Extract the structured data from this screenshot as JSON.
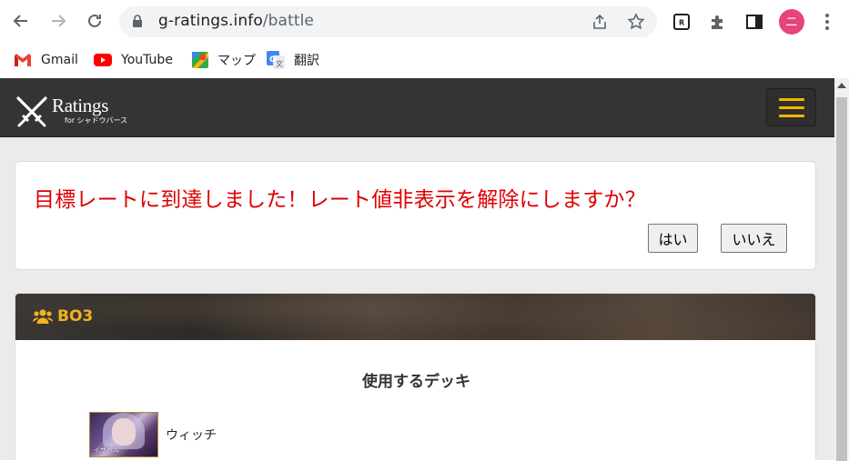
{
  "browser": {
    "url_domain": "g-ratings.info",
    "url_path": "/battle",
    "avatar_letter": "ニ"
  },
  "bookmarks": [
    {
      "label": "Gmail",
      "icon": "gmail-icon"
    },
    {
      "label": "YouTube",
      "icon": "youtube-icon"
    },
    {
      "label": "マップ",
      "icon": "maps-icon"
    },
    {
      "label": "翻訳",
      "icon": "translate-icon"
    }
  ],
  "site": {
    "logo_main": "Ratings",
    "logo_sub": "for シャドウバース",
    "accent_color": "#f5b400"
  },
  "alert": {
    "message": "目標レートに到達しました！レート値非表示を解除にしますか？",
    "yes_label": "はい",
    "no_label": "いいえ",
    "message_color": "#e00000"
  },
  "bo_section": {
    "title": "BO3",
    "deck_heading": "使用するデッキ",
    "decks": [
      {
        "name": "ウィッチ",
        "thumb_caption": "イザベル"
      }
    ]
  }
}
